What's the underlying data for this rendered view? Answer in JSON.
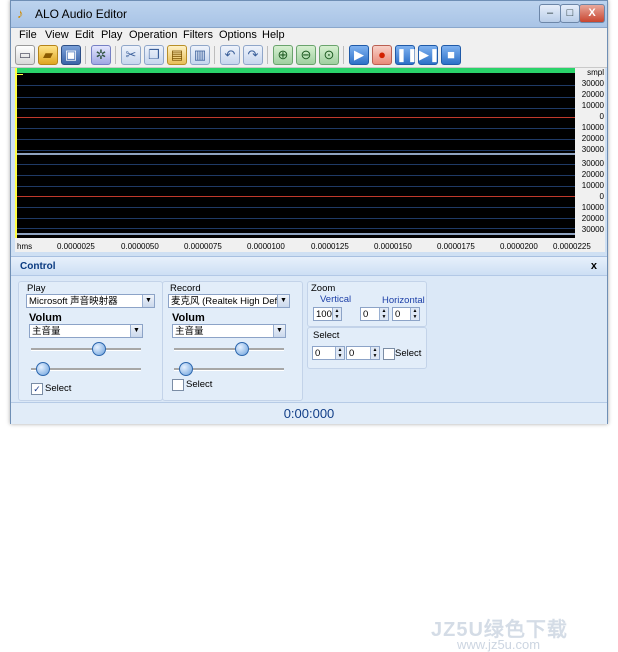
{
  "window": {
    "title": "ALO Audio Editor",
    "buttons": [
      "–",
      "□",
      "X"
    ]
  },
  "menu": [
    "File",
    "View",
    "Edit",
    "Play",
    "Operation",
    "Filters",
    "Options",
    "Help"
  ],
  "toolbar": {
    "icons": [
      "new-file-icon",
      "open-folder-icon",
      "save-icon",
      "settings-icon",
      "cut-icon",
      "copy-icon",
      "paste-icon",
      "paste-mix-icon",
      "undo-icon",
      "redo-icon",
      "zoom-in-icon",
      "zoom-out-icon",
      "zoom-fit-icon",
      "play-icon",
      "record-icon",
      "pause-icon",
      "play-to-end-icon",
      "stop-icon"
    ]
  },
  "waveform": {
    "unit": "smpl",
    "scale_ch1": [
      "30000",
      "20000",
      "10000",
      "0",
      "10000",
      "20000",
      "30000"
    ],
    "scale_ch2": [
      "30000",
      "20000",
      "10000",
      "0",
      "10000",
      "20000",
      "30000"
    ],
    "time_unit": "hms",
    "time_ticks": [
      "0.0000025",
      "0.0000050",
      "0.0000075",
      "0.0000100",
      "0.0000125",
      "0.0000150",
      "0.0000175",
      "0.0000200",
      "0.0000225"
    ],
    "colors": {
      "background": "#000000",
      "center_line_1": "#c0392b",
      "center_line_2": "#ffffff",
      "top_bar": "#2ad36a",
      "grid": "#1f3a66"
    }
  },
  "control": {
    "title": "Control",
    "close": "x",
    "play": {
      "label": "Play",
      "device": "Microsoft 声音映射器",
      "volume_label": "Volum",
      "volume_source": "主音量",
      "select_label": "Select",
      "select_checked": true,
      "slider1": 0.62,
      "slider2": 0.05
    },
    "record": {
      "label": "Record",
      "device": "麦克风 (Realtek High Definiti",
      "volume_label": "Volum",
      "volume_source": "主音量",
      "select_label": "Select",
      "select_checked": false,
      "slider1": 0.62,
      "slider2": 0.05
    },
    "zoom": {
      "label": "Zoom",
      "vertical_label": "Vertical",
      "vertical_value": "100",
      "horizontal_label": "Horizontal",
      "horizontal_a": "0",
      "horizontal_b": "0"
    },
    "select": {
      "label": "Select",
      "a": "0",
      "b": "0",
      "checkbox_label": "Select"
    }
  },
  "status": {
    "time": "0:00:000"
  },
  "watermark": {
    "line1": "JZ5U绿色下载",
    "line2": "www.jz5u.com"
  }
}
